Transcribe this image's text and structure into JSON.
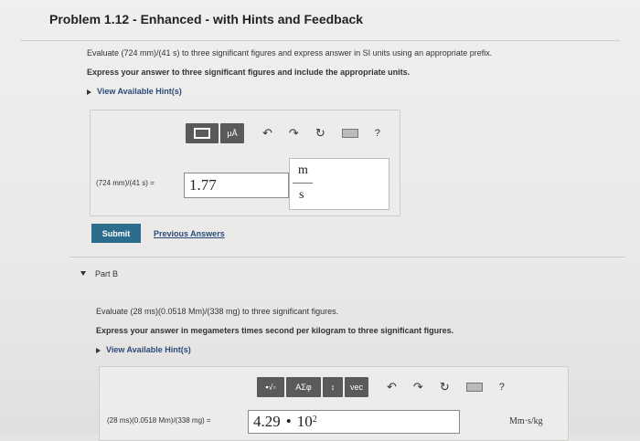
{
  "header": {
    "title": "Problem 1.12 - Enhanced - with Hints and Feedback"
  },
  "part_a": {
    "question": "Evaluate (724 mm)/(41 s) to three significant figures and express answer in SI units using an appropriate prefix.",
    "instruction": "Express your answer to three significant figures and include the appropriate units.",
    "hint_label": "View Available Hint(s)",
    "toolbar": {
      "templates_label": "",
      "units_label": "μÅ"
    },
    "expression_label": "(724 mm)/(41 s) =",
    "answer_value": "1.77",
    "unit_numerator": "m",
    "unit_denominator": "s",
    "submit_label": "Submit",
    "previous_answers_label": "Previous Answers"
  },
  "part_b": {
    "label": "Part B",
    "question": "Evaluate (28 ms)(0.0518 Mm)/(338 mg) to three significant figures.",
    "instruction": "Express your answer in megameters times second per kilogram to three significant figures.",
    "hint_label": "View Available Hint(s)",
    "toolbar": {
      "symbols_label": "ΑΣφ",
      "vec_label": "vec"
    },
    "expression_label": "(28 ms)(0.0518 Mm)/(338 mg) =",
    "answer_mantissa": "4.29",
    "answer_dot": "•",
    "answer_base": "10",
    "answer_exp": "2",
    "units_label": "Mm·s/kg"
  },
  "icons": [
    "undo-icon",
    "redo-icon",
    "reset-icon",
    "keyboard-icon",
    "help-icon",
    "templates-icon",
    "units-icon",
    "sqrt-icon",
    "vector-icon"
  ]
}
